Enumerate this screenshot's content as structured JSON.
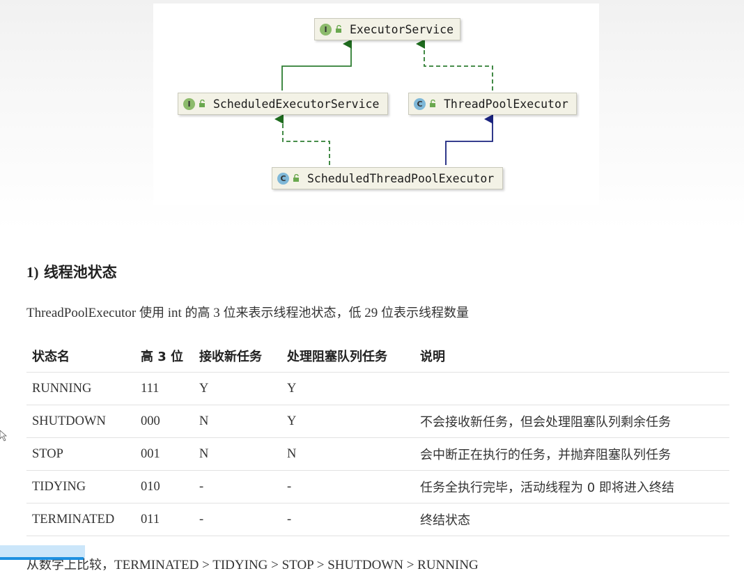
{
  "diagram": {
    "nodes": [
      {
        "id": "executor_service",
        "kind": "I",
        "label": "ExecutorService"
      },
      {
        "id": "scheduled_executor_service",
        "kind": "I",
        "label": "ScheduledExecutorService"
      },
      {
        "id": "thread_pool_executor",
        "kind": "C",
        "label": "ThreadPoolExecutor"
      },
      {
        "id": "scheduled_thread_pool_executor",
        "kind": "C",
        "label": "ScheduledThreadPoolExecutor"
      }
    ],
    "edges": [
      {
        "from": "scheduled_executor_service",
        "to": "executor_service",
        "type": "extends",
        "color": "#2e7d32"
      },
      {
        "from": "thread_pool_executor",
        "to": "executor_service",
        "type": "implements",
        "color": "#2e7d32"
      },
      {
        "from": "scheduled_thread_pool_executor",
        "to": "scheduled_executor_service",
        "type": "implements",
        "color": "#2e7d32"
      },
      {
        "from": "scheduled_thread_pool_executor",
        "to": "thread_pool_executor",
        "type": "extends",
        "color": "#1a237e"
      }
    ],
    "colors": {
      "interface_icon": "#8cbb6b",
      "class_icon": "#7fb8d8",
      "box_fill": "#f3f2e6"
    }
  },
  "section": {
    "heading_num": "1)",
    "heading_text": "线程池状态"
  },
  "intro": {
    "p1": "ThreadPoolExecutor ",
    "p2": "使用",
    "p3": " int ",
    "p4": "的高",
    "p5": " 3 ",
    "p6": "位来表示线程池状态，低",
    "p7": " 29 ",
    "p8": "位表示线程数量"
  },
  "table": {
    "headers": [
      "状态名",
      "高 3 位",
      "接收新任务",
      "处理阻塞队列任务",
      "说明"
    ],
    "rows": [
      [
        "RUNNING",
        "111",
        "Y",
        "Y",
        ""
      ],
      [
        "SHUTDOWN",
        "000",
        "N",
        "Y",
        "不会接收新任务，但会处理阻塞队列剩余任务"
      ],
      [
        "STOP",
        "001",
        "N",
        "N",
        "会中断正在执行的任务，并抛弃阻塞队列任务"
      ],
      [
        "TIDYING",
        "010",
        "-",
        "-",
        "任务全执行完毕，活动线程为 0 即将进入终结"
      ],
      [
        "TERMINATED",
        "011",
        "-",
        "-",
        "终结状态"
      ]
    ]
  },
  "comparison": {
    "prefix": "从数字上比较，",
    "sequence": "TERMINATED > TIDYING > STOP > SHUTDOWN > RUNNING"
  }
}
